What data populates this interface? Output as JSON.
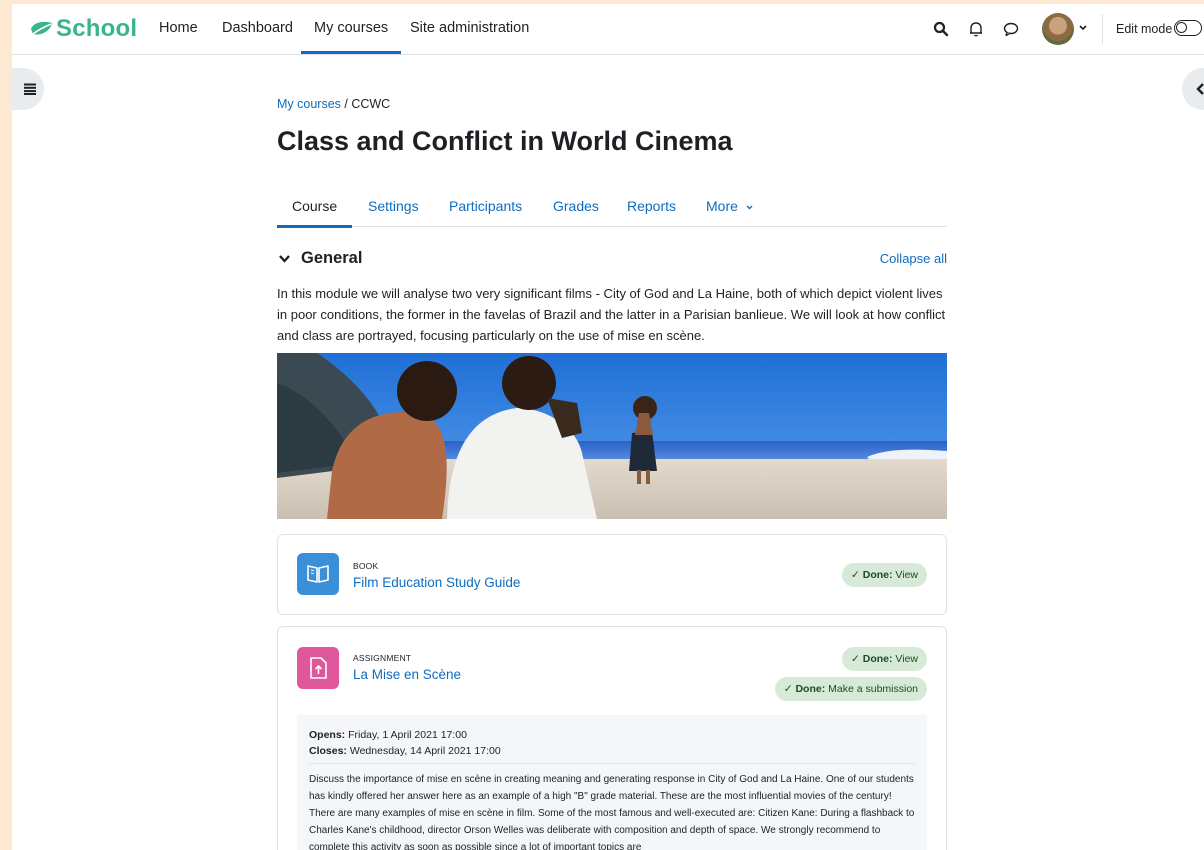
{
  "brand": {
    "name": "School"
  },
  "nav": {
    "items": [
      "Home",
      "Dashboard",
      "My courses",
      "Site administration"
    ],
    "active": "My courses",
    "edit_mode_label": "Edit mode"
  },
  "breadcrumb": {
    "parent": "My courses",
    "separator": " / ",
    "current": "CCWC"
  },
  "page": {
    "title": "Class and Conflict in World Cinema"
  },
  "tabs": {
    "items": [
      "Course",
      "Settings",
      "Participants",
      "Grades",
      "Reports",
      "More"
    ],
    "active": "Course"
  },
  "section": {
    "title": "General",
    "collapse_label": "Collapse all",
    "summary": "In this module we will analyse two very significant films - City of God and La Haine, both of which depict violent lives in poor conditions, the former in the favelas of Brazil and the latter in a Parisian banlieue. We will look at how conflict and class are portrayed, focusing particularly on the use of mise en scène."
  },
  "activities": [
    {
      "type": "BOOK",
      "name": "Film Education Study Guide",
      "icon": "book-icon",
      "color": "#3a8fd9",
      "completion": [
        {
          "prefix": "Done:",
          "label": "View"
        }
      ]
    },
    {
      "type": "ASSIGNMENT",
      "name": "La Mise en Scène",
      "icon": "file-upload-icon",
      "color": "#e0569a",
      "completion": [
        {
          "prefix": "Done:",
          "label": "View"
        },
        {
          "prefix": "Done:",
          "label": "Make a submission"
        }
      ],
      "opens_label": "Opens:",
      "opens_value": "Friday, 1 April 2021 17:00",
      "closes_label": "Closes:",
      "closes_value": "Wednesday, 14 April 2021 17:00",
      "description": "Discuss the importance of  mise en scène in creating meaning and generating response in City of God and La Haine. One of our students has kindly offered her answer here as an example of a high \"B\" grade material. These are the most influential movies of the century! There are many examples of mise en scène in film. Some of the most famous and well-executed are: Citizen Kane: During a flashback to Charles Kane's childhood, director Orson Welles was deliberate with composition and depth of space. We strongly recommend to complete this activity as soon as possible since a lot of important topics are"
    }
  ],
  "colors": {
    "brand": "#39b58d",
    "link": "#0f6cbf",
    "done_bg": "#d7e9d7",
    "page_bg": "#fde8d2"
  }
}
